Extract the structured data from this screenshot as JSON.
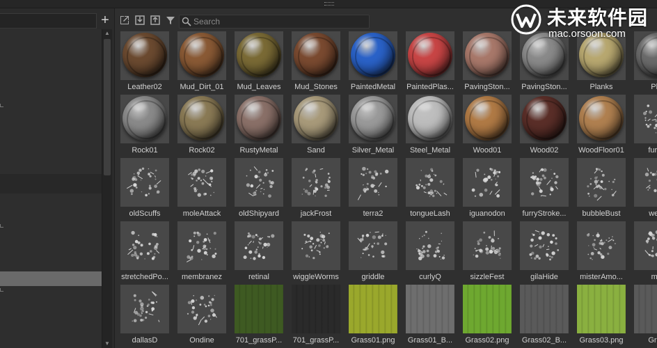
{
  "watermark": {
    "brand": "未来软件园",
    "url": "mac.orsoon.com"
  },
  "search": {
    "placeholder": "Search"
  },
  "items": [
    {
      "label": "Leather02",
      "kind": "sphere",
      "color": "#6b4a30"
    },
    {
      "label": "Mud_Dirt_01",
      "kind": "sphere",
      "color": "#8a5a35"
    },
    {
      "label": "Mud_Leaves",
      "kind": "sphere",
      "color": "#7a6a35"
    },
    {
      "label": "Mud_Stones",
      "kind": "sphere",
      "color": "#7a4a30"
    },
    {
      "label": "PaintedMetal",
      "kind": "sphere",
      "color": "#2a62c8"
    },
    {
      "label": "PaintedPlas...",
      "kind": "sphere",
      "color": "#c84545"
    },
    {
      "label": "PavingSton...",
      "kind": "sphere",
      "color": "#a8786a"
    },
    {
      "label": "PavingSton...",
      "kind": "sphere",
      "color": "#8a8a8a"
    },
    {
      "label": "Planks",
      "kind": "sphere",
      "color": "#b8a870"
    },
    {
      "label": "Plas",
      "kind": "sphere",
      "color": "#6a6a6a"
    },
    {
      "label": "Rock01",
      "kind": "sphere",
      "color": "#8a8a8a"
    },
    {
      "label": "Rock02",
      "kind": "sphere",
      "color": "#8a7a55"
    },
    {
      "label": "RustyMetal",
      "kind": "sphere",
      "color": "#8a7068"
    },
    {
      "label": "Sand",
      "kind": "sphere",
      "color": "#a89a7a"
    },
    {
      "label": "Silver_Metal",
      "kind": "sphere",
      "color": "#9a9a9a"
    },
    {
      "label": "Steel_Metal",
      "kind": "sphere",
      "color": "#bdbdbd"
    },
    {
      "label": "Wood01",
      "kind": "sphere",
      "color": "#b07a45"
    },
    {
      "label": "Wood02",
      "kind": "sphere",
      "color": "#5a2e28"
    },
    {
      "label": "WoodFloor01",
      "kind": "sphere",
      "color": "#b08050"
    },
    {
      "label": "furryS",
      "kind": "stroke",
      "color": "#444"
    },
    {
      "label": "oldScuffs",
      "kind": "stroke",
      "color": "#444"
    },
    {
      "label": "moleAttack",
      "kind": "stroke",
      "color": "#444"
    },
    {
      "label": "oldShipyard",
      "kind": "stroke",
      "color": "#444"
    },
    {
      "label": "jackFrost",
      "kind": "stroke",
      "color": "#444"
    },
    {
      "label": "terra2",
      "kind": "stroke",
      "color": "#444"
    },
    {
      "label": "tongueLash",
      "kind": "stroke",
      "color": "#444"
    },
    {
      "label": "iguanodon",
      "kind": "stroke",
      "color": "#444"
    },
    {
      "label": "furryStroke...",
      "kind": "stroke",
      "color": "#444"
    },
    {
      "label": "bubbleBust",
      "kind": "stroke",
      "color": "#444"
    },
    {
      "label": "wellin",
      "kind": "stroke",
      "color": "#444"
    },
    {
      "label": "stretchedPo...",
      "kind": "stroke",
      "color": "#444"
    },
    {
      "label": "membranez",
      "kind": "stroke",
      "color": "#444"
    },
    {
      "label": "retinal",
      "kind": "stroke",
      "color": "#444"
    },
    {
      "label": "wiggleWorms",
      "kind": "stroke",
      "color": "#444"
    },
    {
      "label": "griddle",
      "kind": "stroke",
      "color": "#444"
    },
    {
      "label": "curlyQ",
      "kind": "stroke",
      "color": "#444"
    },
    {
      "label": "sizzleFest",
      "kind": "stroke",
      "color": "#444"
    },
    {
      "label": "gilaHide",
      "kind": "stroke",
      "color": "#444"
    },
    {
      "label": "misterAmo...",
      "kind": "stroke",
      "color": "#444"
    },
    {
      "label": "maz",
      "kind": "stroke",
      "color": "#444"
    },
    {
      "label": "dallasD",
      "kind": "stroke",
      "color": "#444"
    },
    {
      "label": "Ondine",
      "kind": "stroke",
      "color": "#444"
    },
    {
      "label": "701_grassP...",
      "kind": "flat",
      "color": "#3e5a22"
    },
    {
      "label": "701_grassP...",
      "kind": "flat",
      "color": "#2a2a2a"
    },
    {
      "label": "Grass01.png",
      "kind": "flat",
      "color": "#9aa82c"
    },
    {
      "label": "Grass01_B...",
      "kind": "flat",
      "color": "#6e6e6e"
    },
    {
      "label": "Grass02.png",
      "kind": "flat",
      "color": "#6ea830"
    },
    {
      "label": "Grass02_B...",
      "kind": "flat",
      "color": "#5a5a5a"
    },
    {
      "label": "Grass03.png",
      "kind": "flat",
      "color": "#8ab040"
    },
    {
      "label": "Grass",
      "kind": "flat",
      "color": "#5a5a5a"
    }
  ]
}
